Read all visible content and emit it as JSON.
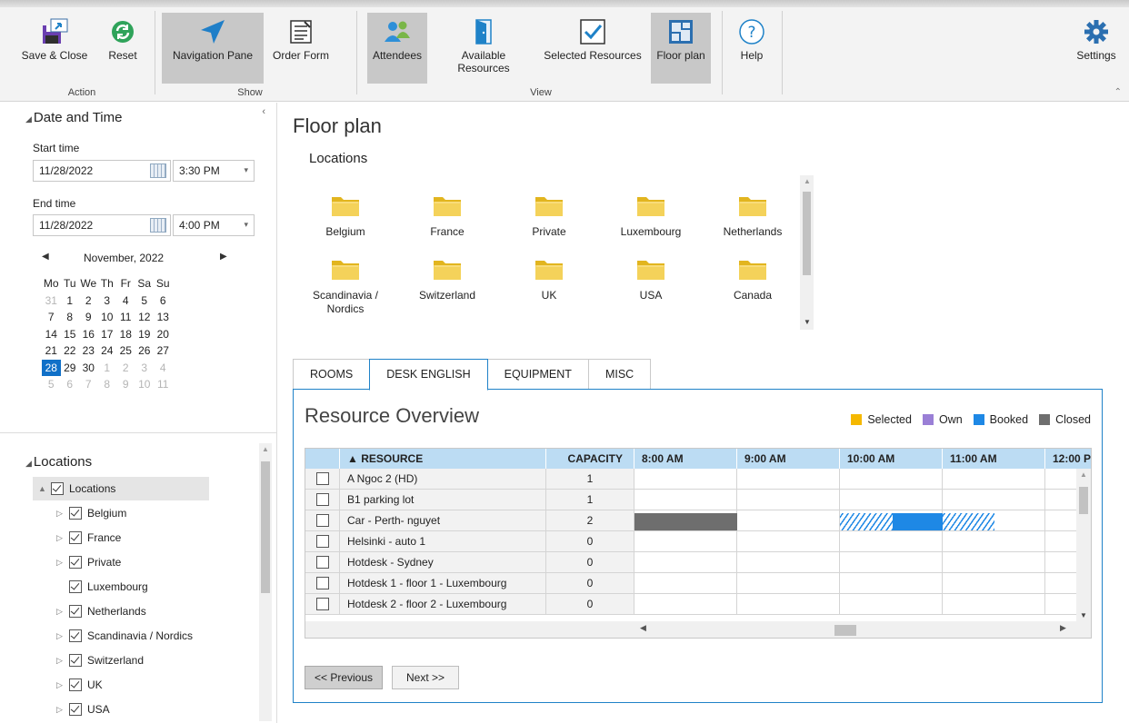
{
  "ribbon": {
    "buttons": [
      {
        "id": "save",
        "label": "Save & Close",
        "icon": "save-close-icon"
      },
      {
        "id": "reset",
        "label": "Reset",
        "icon": "reset-icon"
      },
      {
        "id": "navpane",
        "label": "Navigation Pane",
        "icon": "navigation-icon",
        "active": true
      },
      {
        "id": "orderform",
        "label": "Order Form",
        "icon": "order-form-icon"
      },
      {
        "id": "attendees",
        "label": "Attendees",
        "icon": "attendees-icon",
        "active": true
      },
      {
        "id": "available",
        "label_line1": "Available",
        "label_line2": "Resources",
        "icon": "door-icon"
      },
      {
        "id": "selected",
        "label": "Selected Resources",
        "icon": "checkbox-icon"
      },
      {
        "id": "floorplan",
        "label": "Floor plan",
        "icon": "floor-plan-icon",
        "active": true
      },
      {
        "id": "help",
        "label": "Help",
        "icon": "help-icon"
      },
      {
        "id": "settings",
        "label": "Settings",
        "icon": "gear-icon"
      }
    ],
    "groups": {
      "action": "Action",
      "show": "Show",
      "view": "View"
    }
  },
  "left": {
    "date_time_title": "Date and Time",
    "start_label": "Start time",
    "start_date": "11/28/2022",
    "start_time": "3:30 PM",
    "end_label": "End time",
    "end_date": "11/28/2022",
    "end_time": "4:00 PM",
    "calendar": {
      "month": "November, 2022",
      "weekdays": [
        "Mo",
        "Tu",
        "We",
        "Th",
        "Fr",
        "Sa",
        "Su"
      ],
      "weeks": [
        [
          {
            "d": "31",
            "m": true
          },
          {
            "d": "1"
          },
          {
            "d": "2"
          },
          {
            "d": "3"
          },
          {
            "d": "4"
          },
          {
            "d": "5"
          },
          {
            "d": "6"
          }
        ],
        [
          {
            "d": "7"
          },
          {
            "d": "8"
          },
          {
            "d": "9"
          },
          {
            "d": "10"
          },
          {
            "d": "11"
          },
          {
            "d": "12"
          },
          {
            "d": "13"
          }
        ],
        [
          {
            "d": "14"
          },
          {
            "d": "15"
          },
          {
            "d": "16"
          },
          {
            "d": "17"
          },
          {
            "d": "18"
          },
          {
            "d": "19"
          },
          {
            "d": "20"
          }
        ],
        [
          {
            "d": "21"
          },
          {
            "d": "22"
          },
          {
            "d": "23"
          },
          {
            "d": "24"
          },
          {
            "d": "25"
          },
          {
            "d": "26"
          },
          {
            "d": "27"
          }
        ],
        [
          {
            "d": "28",
            "s": true
          },
          {
            "d": "29"
          },
          {
            "d": "30"
          },
          {
            "d": "1",
            "m": true
          },
          {
            "d": "2",
            "m": true
          },
          {
            "d": "3",
            "m": true
          },
          {
            "d": "4",
            "m": true
          }
        ],
        [
          {
            "d": "5",
            "m": true
          },
          {
            "d": "6",
            "m": true
          },
          {
            "d": "7",
            "m": true
          },
          {
            "d": "8",
            "m": true
          },
          {
            "d": "9",
            "m": true
          },
          {
            "d": "10",
            "m": true
          },
          {
            "d": "11",
            "m": true
          }
        ]
      ]
    },
    "locations_title": "Locations",
    "tree": [
      {
        "label": "Locations",
        "level": 0,
        "expander": "▲"
      },
      {
        "label": "Belgium",
        "level": 1,
        "expander": "▷"
      },
      {
        "label": "France",
        "level": 1,
        "expander": "▷"
      },
      {
        "label": "Private",
        "level": 1,
        "expander": "▷"
      },
      {
        "label": "Luxembourg",
        "level": 1,
        "expander": ""
      },
      {
        "label": "Netherlands",
        "level": 1,
        "expander": "▷"
      },
      {
        "label": "Scandinavia / Nordics",
        "level": 1,
        "expander": "▷"
      },
      {
        "label": "Switzerland",
        "level": 1,
        "expander": "▷"
      },
      {
        "label": "UK",
        "level": 1,
        "expander": "▷"
      },
      {
        "label": "USA",
        "level": 1,
        "expander": "▷"
      }
    ]
  },
  "main": {
    "title": "Floor plan",
    "locations_label": "Locations",
    "folders": [
      {
        "name": "Belgium"
      },
      {
        "name": "France"
      },
      {
        "name": "Private"
      },
      {
        "name": "Luxembourg"
      },
      {
        "name": "Netherlands"
      },
      {
        "name": "Scandinavia /\nNordics"
      },
      {
        "name": "Switzerland"
      },
      {
        "name": "UK"
      },
      {
        "name": "USA"
      },
      {
        "name": "Canada"
      }
    ],
    "tabs": [
      "ROOMS",
      "DESK ENGLISH",
      "EQUIPMENT",
      "MISC"
    ],
    "active_tab": 1,
    "overview_title": "Resource Overview",
    "legend": [
      {
        "label": "Selected",
        "color": "#f5b800"
      },
      {
        "label": "Own",
        "color": "#9a7fd6"
      },
      {
        "label": "Booked",
        "color": "#1e88e5"
      },
      {
        "label": "Closed",
        "color": "#6e6e6e"
      }
    ],
    "grid": {
      "col_resource": "▲  RESOURCE",
      "col_capacity": "CAPACITY",
      "times": [
        "8:00 AM",
        "9:00 AM",
        "10:00 AM",
        "11:00 AM",
        "12:00 P"
      ],
      "rows": [
        {
          "name": "A Ngoc 2 (HD)",
          "capacity": "1"
        },
        {
          "name": "B1 parking lot",
          "capacity": "1"
        },
        {
          "name": "Car - Perth- nguyet",
          "capacity": "2"
        },
        {
          "name": "Helsinki - auto 1",
          "capacity": "0"
        },
        {
          "name": "Hotdesk - Sydney",
          "capacity": "0"
        },
        {
          "name": "Hotdesk 1 - floor 1 - Luxembourg",
          "capacity": "0"
        },
        {
          "name": "Hotdesk 2 - floor 2 - Luxembourg",
          "capacity": "0"
        }
      ]
    },
    "prev_label": "<< Previous",
    "next_label": "Next >>"
  }
}
